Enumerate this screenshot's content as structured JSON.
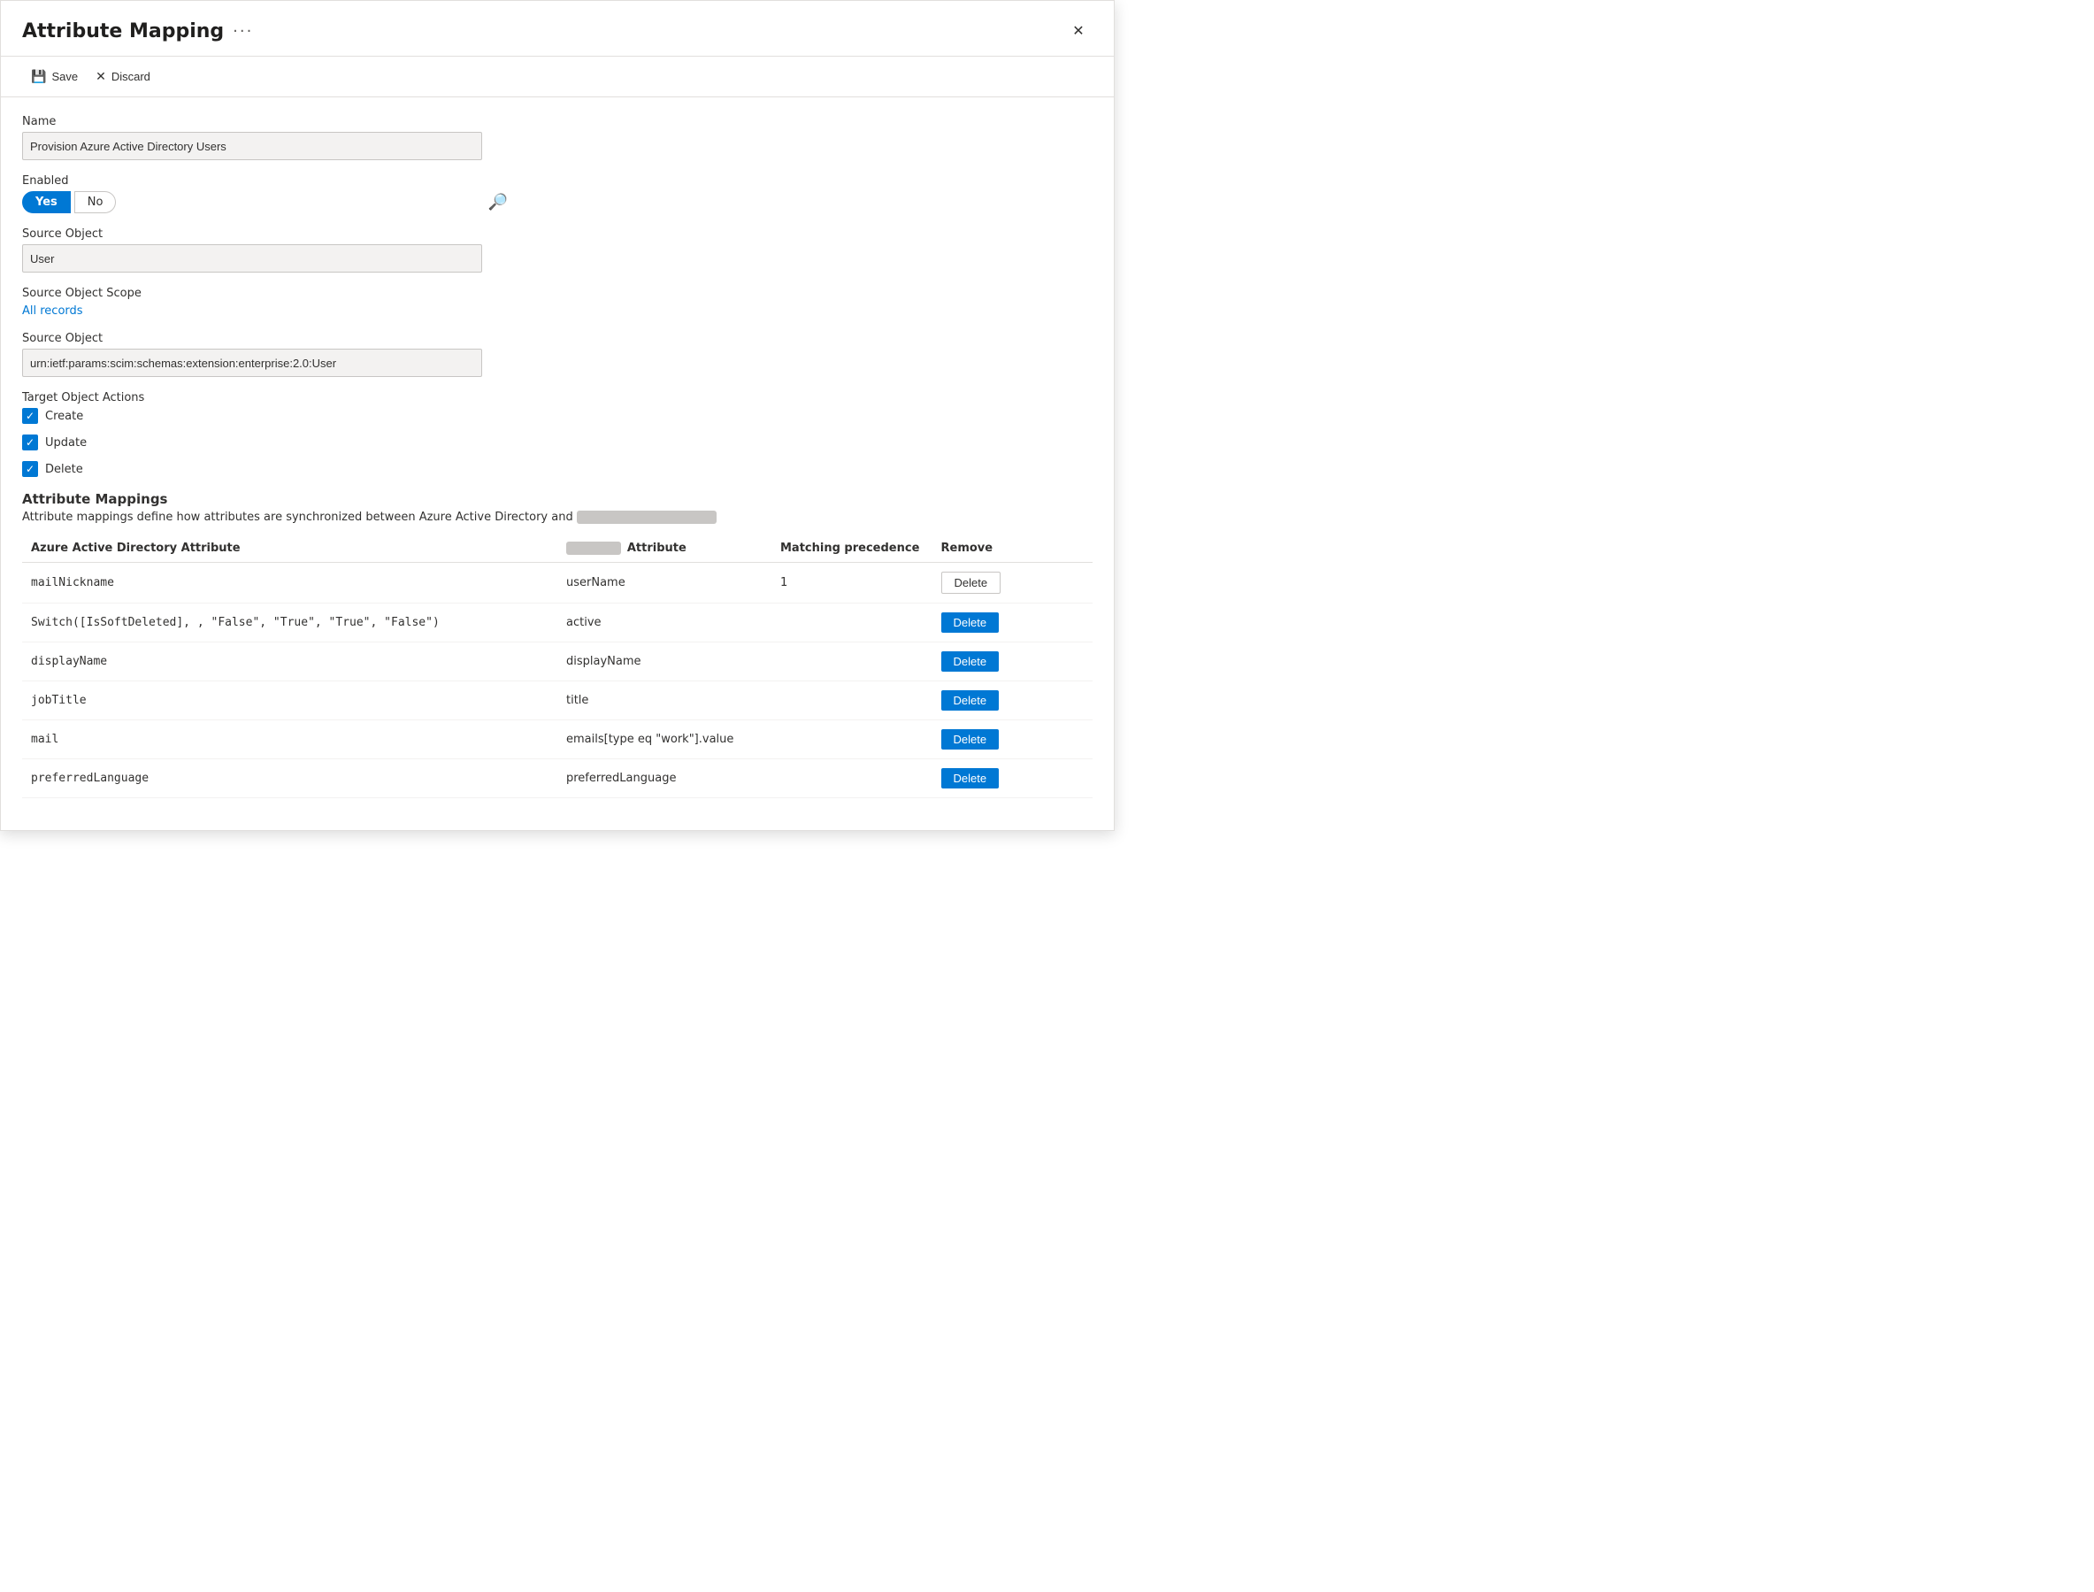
{
  "dialog": {
    "title": "Attribute Mapping",
    "more_icon": "···",
    "close_icon": "✕"
  },
  "toolbar": {
    "save_label": "Save",
    "discard_label": "Discard"
  },
  "form": {
    "name_label": "Name",
    "name_value": "Provision Azure Active Directory Users",
    "enabled_label": "Enabled",
    "toggle_yes": "Yes",
    "toggle_no": "No",
    "source_object_label": "Source Object",
    "source_object_value": "User",
    "source_object_scope_label": "Source Object Scope",
    "all_records_link": "All records",
    "target_object_label": "Source Object",
    "target_object_value": "urn:ietf:params:scim:schemas:extension:enterprise:2.0:User",
    "target_object_actions_label": "Target Object Actions",
    "action_create": "Create",
    "action_update": "Update",
    "action_delete": "Delete"
  },
  "attribute_mappings_section": {
    "title": "Attribute Mappings",
    "description_prefix": "Attribute mappings define how attributes are synchronized between Azure Active Directory and ",
    "description_blurred": "██████████",
    "col_aad": "Azure Active Directory Attribute",
    "col_attr_blurred": "████████████",
    "col_attr_suffix": "Attribute",
    "col_match": "Matching precedence",
    "col_remove": "Remove"
  },
  "table_rows": [
    {
      "aad_attr": "mailNickname",
      "target_attr": "userName",
      "match_precedence": "1",
      "delete_btn_style": "outline",
      "delete_label": "Delete"
    },
    {
      "aad_attr": "Switch([IsSoftDeleted], , \"False\", \"True\", \"True\", \"False\")",
      "target_attr": "active",
      "match_precedence": "",
      "delete_btn_style": "blue",
      "delete_label": "Delete"
    },
    {
      "aad_attr": "displayName",
      "target_attr": "displayName",
      "match_precedence": "",
      "delete_btn_style": "blue",
      "delete_label": "Delete"
    },
    {
      "aad_attr": "jobTitle",
      "target_attr": "title",
      "match_precedence": "",
      "delete_btn_style": "blue",
      "delete_label": "Delete"
    },
    {
      "aad_attr": "mail",
      "target_attr": "emails[type eq \"work\"].value",
      "match_precedence": "",
      "delete_btn_style": "blue",
      "delete_label": "Delete"
    },
    {
      "aad_attr": "preferredLanguage",
      "target_attr": "preferredLanguage",
      "match_precedence": "",
      "delete_btn_style": "blue",
      "delete_label": "Delete"
    }
  ]
}
